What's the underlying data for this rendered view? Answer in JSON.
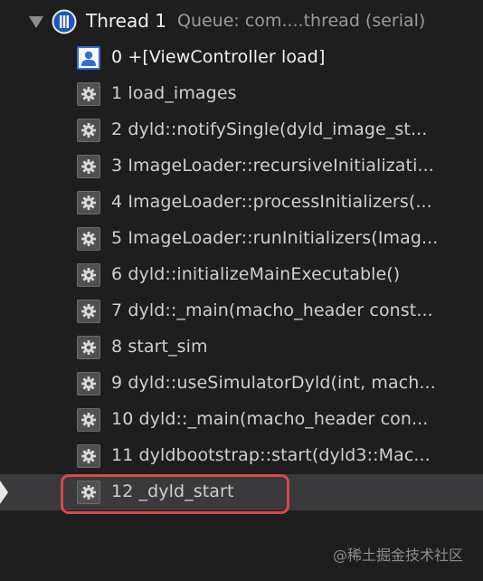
{
  "thread": {
    "title": "Thread 1",
    "queue": "Queue: com....thread (serial)",
    "icon": "thread-icon"
  },
  "frames": [
    {
      "label": "0 +[ViewController load]",
      "icon": "user-icon"
    },
    {
      "label": "1 load_images",
      "icon": "gear-icon"
    },
    {
      "label": "2 dyld::notifySingle(dyld_image_st...",
      "icon": "gear-icon"
    },
    {
      "label": "3 ImageLoader::recursiveInitializati...",
      "icon": "gear-icon"
    },
    {
      "label": "4 ImageLoader::processInitializers(...",
      "icon": "gear-icon"
    },
    {
      "label": "5 ImageLoader::runInitializers(Imag...",
      "icon": "gear-icon"
    },
    {
      "label": "6 dyld::initializeMainExecutable()",
      "icon": "gear-icon"
    },
    {
      "label": "7 dyld::_main(macho_header const...",
      "icon": "gear-icon"
    },
    {
      "label": "8 start_sim",
      "icon": "gear-icon"
    },
    {
      "label": "9 dyld::useSimulatorDyld(int, mach...",
      "icon": "gear-icon"
    },
    {
      "label": "10 dyld::_main(macho_header con...",
      "icon": "gear-icon"
    },
    {
      "label": "11 dyldbootstrap::start(dyld3::Mac...",
      "icon": "gear-icon"
    },
    {
      "label": "12 _dyld_start",
      "icon": "gear-icon"
    }
  ],
  "selected_frame": "12 _dyld_start",
  "watermark": "@稀土掘金技术社区",
  "colors": {
    "background": "#1e1e1f",
    "highlight": "#d9484b",
    "selection": "#3a3a3c",
    "user_icon": "#2f6fd6"
  }
}
